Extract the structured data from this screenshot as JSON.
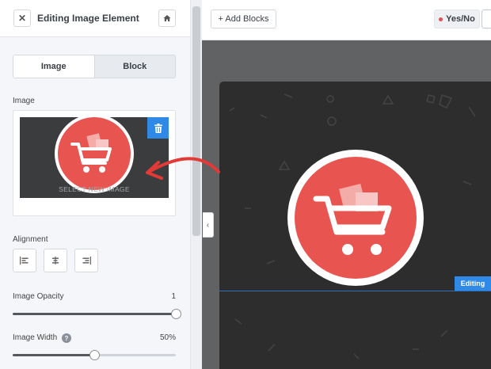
{
  "panel": {
    "title": "Editing Image Element",
    "close_icon": "close-icon",
    "home_icon": "home-icon",
    "tabs": [
      {
        "label": "Image",
        "active": true
      },
      {
        "label": "Block",
        "active": false
      }
    ],
    "image_field": {
      "label": "Image",
      "select_text": "SELECT NEW IMAGE",
      "delete_icon": "trash-icon"
    },
    "alignment": {
      "label": "Alignment",
      "options": [
        "align-left-icon",
        "align-center-icon",
        "align-right-icon"
      ]
    },
    "opacity": {
      "label": "Image Opacity",
      "value_text": "1",
      "fraction": 1.0
    },
    "width": {
      "label": "Image Width",
      "help_glyph": "?",
      "value_text": "50%",
      "fraction": 0.5
    }
  },
  "toolbar": {
    "add_blocks_label": "+ Add Blocks",
    "yes_no_label": "Yes/No"
  },
  "canvas": {
    "editing_badge": "Editing",
    "collapse_glyph": "‹"
  },
  "colors": {
    "accent": "#2e8ae6",
    "logo_red": "#e8544f",
    "canvas_dark": "#2d2d2d",
    "annotation_arrow": "#e23a36"
  }
}
